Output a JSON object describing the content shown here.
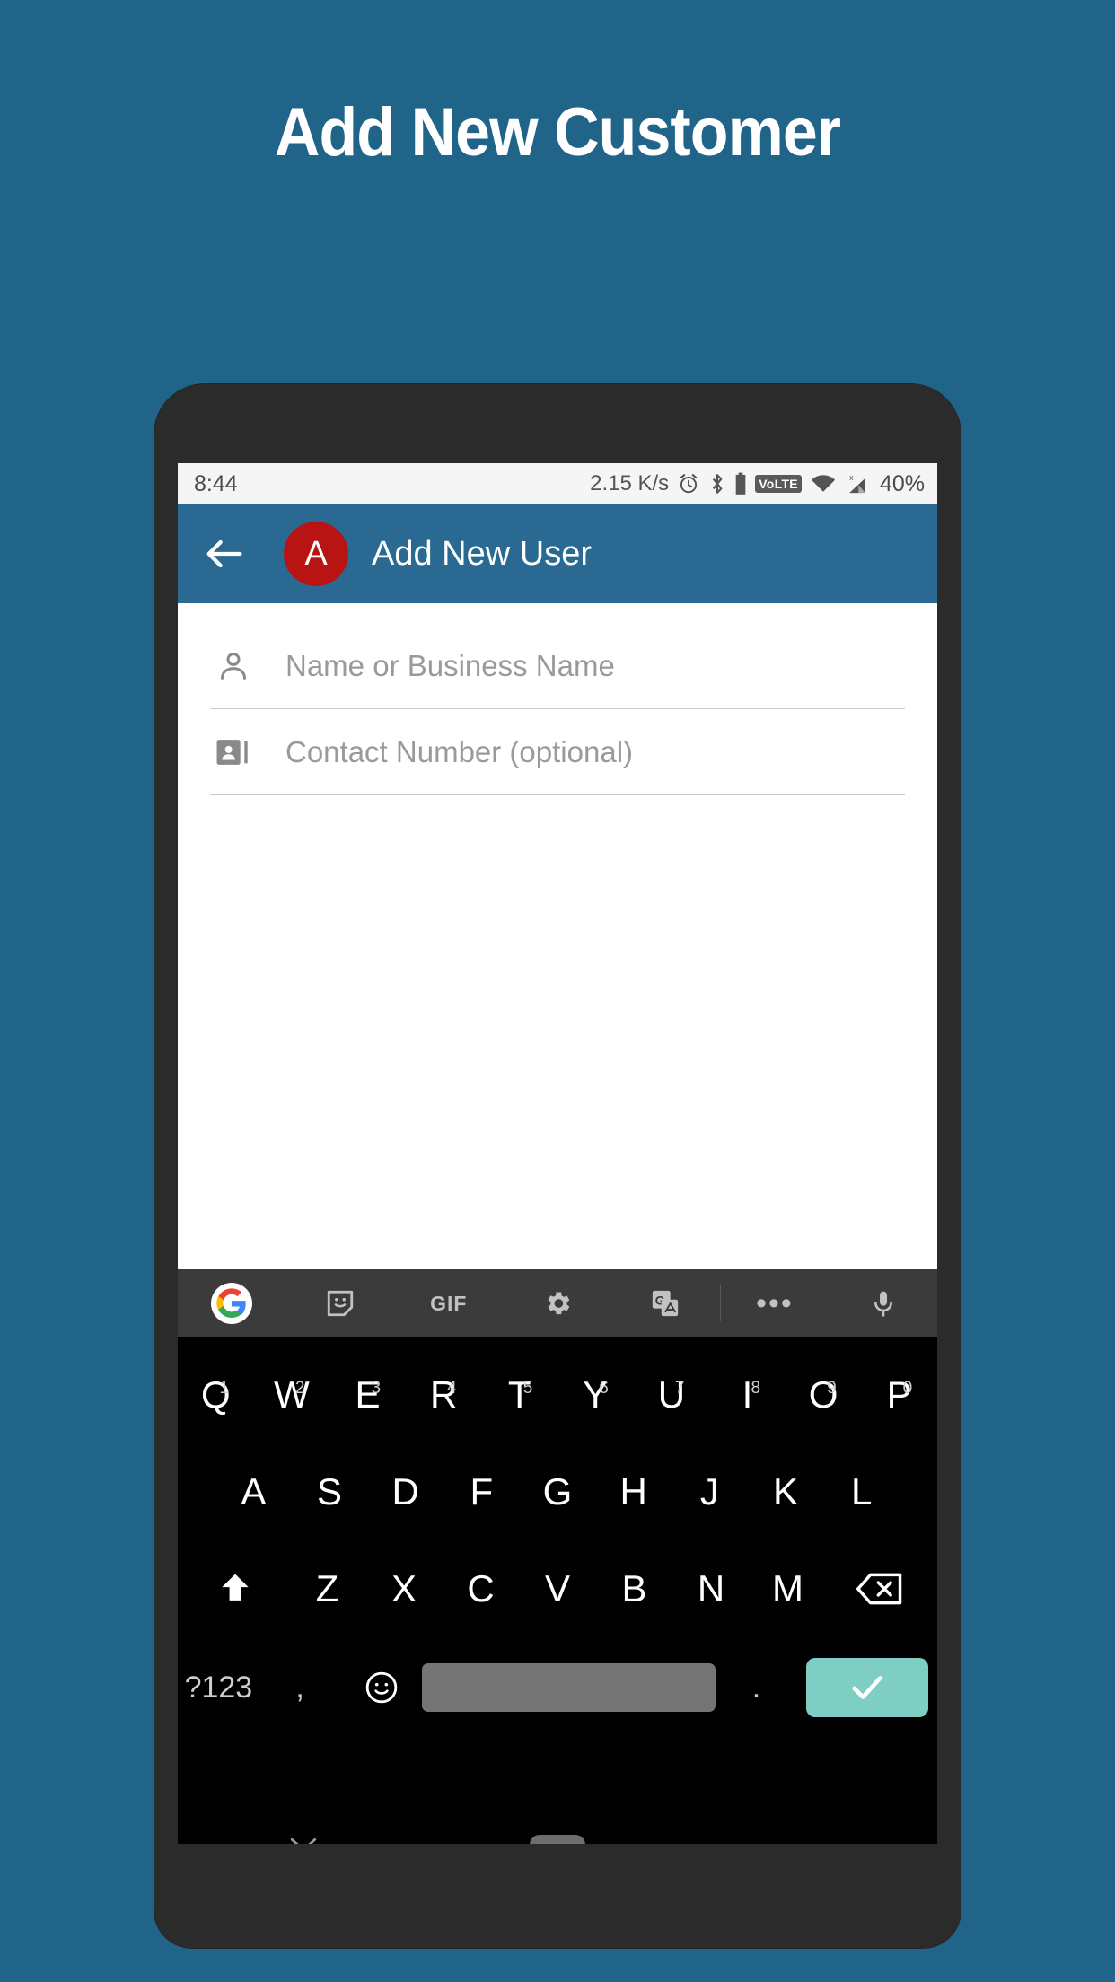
{
  "promo": {
    "title": "Add New Customer",
    "background_color": "#20648a"
  },
  "statusbar": {
    "time": "8:44",
    "network_speed": "2.15 K/s",
    "volte_label": "VoLTE",
    "battery": "40%",
    "icons": [
      "alarm-icon",
      "bluetooth-icon",
      "battery-icon",
      "volte-badge",
      "wifi-icon",
      "cellular-signal-icon"
    ]
  },
  "appbar": {
    "back_label": "Back",
    "avatar_letter": "A",
    "avatar_color": "#b81414",
    "title": "Add New User",
    "background_color": "#2a6a92"
  },
  "form": {
    "fields": [
      {
        "icon": "person-icon",
        "placeholder": "Name or Business Name",
        "value": ""
      },
      {
        "icon": "contact-card-icon",
        "placeholder": "Contact Number (optional)",
        "value": ""
      }
    ]
  },
  "keyboard_toolbar": {
    "items": [
      {
        "name": "google-logo-icon",
        "label": ""
      },
      {
        "name": "sticker-icon",
        "label": ""
      },
      {
        "name": "gif-icon",
        "label": "GIF"
      },
      {
        "name": "settings-gear-icon",
        "label": ""
      },
      {
        "name": "translate-icon",
        "label": ""
      },
      {
        "name": "more-options-icon",
        "label": "•••"
      },
      {
        "name": "microphone-icon",
        "label": ""
      }
    ]
  },
  "keyboard": {
    "row1": [
      {
        "key": "Q",
        "num": "1"
      },
      {
        "key": "W",
        "num": "2"
      },
      {
        "key": "E",
        "num": "3"
      },
      {
        "key": "R",
        "num": "4"
      },
      {
        "key": "T",
        "num": "5"
      },
      {
        "key": "Y",
        "num": "6"
      },
      {
        "key": "U",
        "num": "7"
      },
      {
        "key": "I",
        "num": "8"
      },
      {
        "key": "O",
        "num": "9"
      },
      {
        "key": "P",
        "num": "0"
      }
    ],
    "row2": [
      "A",
      "S",
      "D",
      "F",
      "G",
      "H",
      "J",
      "K",
      "L"
    ],
    "row3": [
      "Z",
      "X",
      "C",
      "V",
      "B",
      "N",
      "M"
    ],
    "shift_label": "shift-key",
    "backspace_label": "backspace-key",
    "row4": {
      "symbols_key": "?123",
      "comma_key": ",",
      "emoji_key": "☺",
      "space_key": "",
      "period_key": ".",
      "enter_key": "✓",
      "enter_color": "#7ecec4"
    }
  },
  "navbar": {
    "hide_keyboard": "chevron-down-icon",
    "home_pill": "home-indicator"
  }
}
